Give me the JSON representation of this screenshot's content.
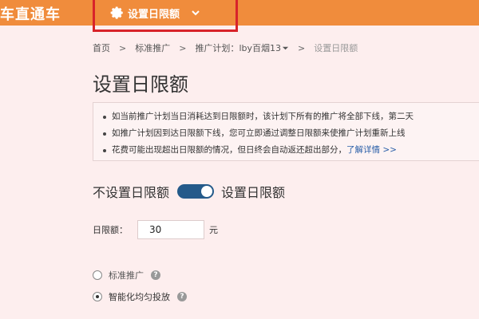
{
  "app": {
    "brand": "车直通车"
  },
  "menu": {
    "active_item": "设置日限额",
    "icon": "gear-icon"
  },
  "breadcrumb": {
    "home": "首页",
    "standard": "标准推广",
    "plan_prefix": "推广计划：",
    "plan_name": "lby百烟13",
    "current": "设置日限额"
  },
  "page": {
    "title": "设置日限额"
  },
  "notice": {
    "items": [
      "如当前推广计划当日消耗达到日限额时，该计划下所有的推广将全部下线，第二天",
      "如推广计划因到达日限额下线，您可立即通过调整日限额来使推广计划重新上线",
      "花费可能出现超出日限额的情况，但日终会自动返还超出部分，"
    ],
    "link": "了解详情 >>"
  },
  "toggle": {
    "off_label": "不设置日限额",
    "on_label": "设置日限额",
    "state": "on"
  },
  "limit": {
    "label": "日限额：",
    "value": "30",
    "unit": "元"
  },
  "delivery": {
    "options": [
      {
        "label": "标准推广",
        "selected": false
      },
      {
        "label": "智能化均匀投放",
        "selected": true
      }
    ],
    "help_glyph": "?"
  },
  "colors": {
    "topbar": "#f08c3c",
    "highlight_box": "#d8232a",
    "switch": "#245a8a",
    "link": "#2a5fa8"
  }
}
